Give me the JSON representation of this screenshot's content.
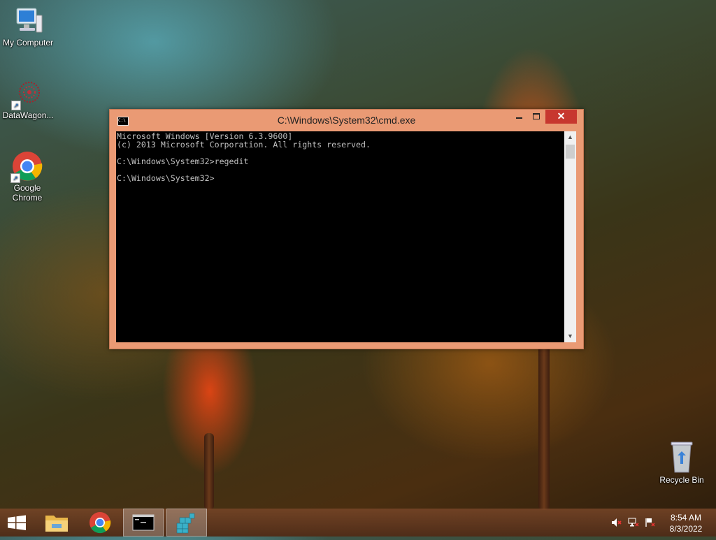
{
  "desktop": {
    "icons": [
      {
        "label": "My Computer",
        "icon": "computer-icon"
      },
      {
        "label": "DataWagon...",
        "icon": "datawagon-icon"
      },
      {
        "label": "Google Chrome",
        "icon": "chrome-icon"
      },
      {
        "label": "Recycle Bin",
        "icon": "recycle-bin-icon"
      }
    ]
  },
  "window": {
    "title": "C:\\Windows\\System32\\cmd.exe",
    "icon_text": "C:\\",
    "close_glyph": "✕",
    "console_text": "Microsoft Windows [Version 6.3.9600]\n(c) 2013 Microsoft Corporation. All rights reserved.\n\nC:\\Windows\\System32>regedit\n\nC:\\Windows\\System32>",
    "console_bg": "#000000",
    "console_fg": "#c0c0c0",
    "frame_color": "#ea9a74",
    "close_color": "#c7372f"
  },
  "taskbar": {
    "items": [
      {
        "icon": "windows-start-icon"
      },
      {
        "icon": "file-explorer-icon"
      },
      {
        "icon": "chrome-icon"
      },
      {
        "icon": "cmd-icon",
        "active": true
      },
      {
        "icon": "regedit-icon"
      }
    ],
    "tray": [
      "speaker-muted-icon",
      "network-icon",
      "action-center-icon"
    ],
    "clock": {
      "time": "8:54 AM",
      "date": "8/3/2022"
    }
  }
}
